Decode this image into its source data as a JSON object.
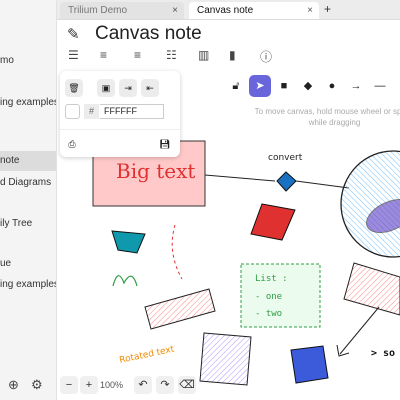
{
  "sidebar": {
    "items": [
      {
        "label": "mo"
      },
      {
        "label": "ing examples"
      },
      {
        "label": "note"
      },
      {
        "label": "d Diagrams"
      },
      {
        "label": "ily Tree"
      },
      {
        "label": "ue"
      },
      {
        "label": "ing examples"
      }
    ],
    "footer_icons": [
      "target-icon",
      "gear-icon"
    ]
  },
  "tabs": [
    {
      "label": "Trilium Demo",
      "close": "×"
    },
    {
      "label": "Canvas note",
      "close": "×"
    }
  ],
  "new_tab_label": "+",
  "note": {
    "title": "Canvas note",
    "ribbon_icons": [
      "sliders-icon",
      "text-settings-icon",
      "list-add-icon",
      "stack-icon",
      "map-icon",
      "bar-chart-icon",
      "info-icon"
    ]
  },
  "canvas": {
    "hint": "To move canvas, hold mouse wheel or space while dragging",
    "toolbar": [
      "lock-icon",
      "pointer-icon",
      "rectangle-icon",
      "diamond-icon",
      "ellipse-icon",
      "arrow-icon",
      "line-icon",
      "pencil-icon"
    ],
    "properties": {
      "actions": [
        "trash-icon",
        "copy-icon",
        "send-to-back-icon",
        "bring-forward-icon"
      ],
      "hash": "#",
      "color_value": "FFFFFF",
      "bottom_icons": [
        "export-file-icon",
        "save-icon"
      ]
    },
    "texts": {
      "big_text": "Big text",
      "convert": "convert",
      "list_title": "List :",
      "list_item_1": "- one",
      "list_item_2": "- two",
      "rotated": "Rotated text",
      "partial": "> so"
    },
    "zoom": {
      "minus": "−",
      "plus": "+",
      "level": "100%"
    },
    "colors": {
      "accent": "#6965db",
      "red_text": "#e03131",
      "green_text": "#2f9e44",
      "orange_text": "#f08c00",
      "pink_fill": "#ffc9c9",
      "blue_fill": "#a5d8ff"
    }
  }
}
